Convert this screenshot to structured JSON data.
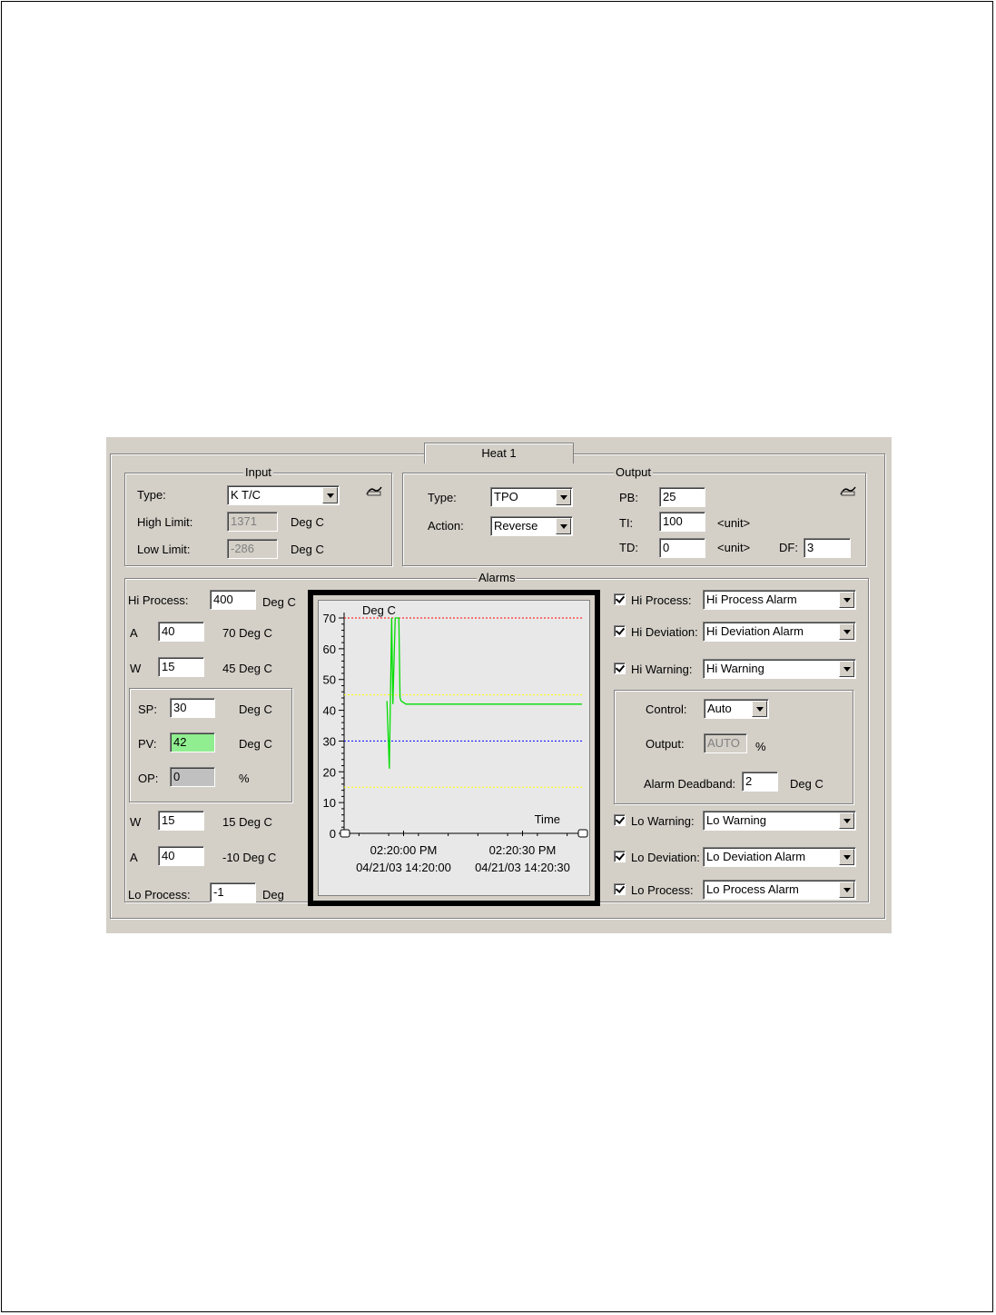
{
  "tab": {
    "label": "Heat 1"
  },
  "input": {
    "title": "Input",
    "type_label": "Type:",
    "type_value": "K T/C",
    "high_limit_label": "High Limit:",
    "high_limit_value": "1371",
    "high_limit_unit": "Deg C",
    "low_limit_label": "Low Limit:",
    "low_limit_value": "-286",
    "low_limit_unit": "Deg C"
  },
  "output": {
    "title": "Output",
    "type_label": "Type:",
    "type_value": "TPO",
    "action_label": "Action:",
    "action_value": "Reverse",
    "pb_label": "PB:",
    "pb_value": "25",
    "ti_label": "TI:",
    "ti_value": "100",
    "ti_unit": "<unit>",
    "td_label": "TD:",
    "td_value": "0",
    "td_unit": "<unit>",
    "df_label": "DF:",
    "df_value": "3"
  },
  "alarms": {
    "title": "Alarms",
    "hi_process_label": "Hi Process:",
    "hi_process_value": "400",
    "hi_process_unit": "Deg C",
    "a_hi_label": "A",
    "a_hi_value": "40",
    "a_hi_result": "70  Deg C",
    "w_hi_label": "W",
    "w_hi_value": "15",
    "w_hi_result": "45  Deg C",
    "sp_label": "SP:",
    "sp_value": "30",
    "sp_unit": "Deg C",
    "pv_label": "PV:",
    "pv_value": "42",
    "pv_unit": "Deg C",
    "op_label": "OP:",
    "op_value": "0",
    "op_unit": "%",
    "w_lo_label": "W",
    "w_lo_value": "15",
    "w_lo_result": "15  Deg C",
    "a_lo_label": "A",
    "a_lo_value": "40",
    "a_lo_result": "-10  Deg C",
    "lo_process_label": "Lo Process:",
    "lo_process_value": "-1",
    "lo_process_unit": "Deg",
    "right": {
      "hi_process_label": "Hi Process:",
      "hi_process_value": "Hi Process Alarm",
      "hi_deviation_label": "Hi Deviation:",
      "hi_deviation_value": "Hi Deviation Alarm",
      "hi_warning_label": "Hi Warning:",
      "hi_warning_value": "Hi Warning",
      "control_label": "Control:",
      "control_value": "Auto",
      "output_label": "Output:",
      "output_value": "AUTO",
      "output_unit": "%",
      "deadband_label": "Alarm Deadband:",
      "deadband_value": "2",
      "deadband_unit": "Deg C",
      "lo_warning_label": "Lo Warning:",
      "lo_warning_value": "Lo Warning",
      "lo_deviation_label": "Lo Deviation:",
      "lo_deviation_value": "Lo Deviation Alarm",
      "lo_process_label": "Lo Process:",
      "lo_process_value": "Lo Process Alarm"
    }
  },
  "colors": {
    "panel": "#d4d0c8",
    "pv_line": "#00dd00",
    "alarm_line": "#ff0000",
    "warning_line": "#ffff00",
    "setpoint_line": "#0000ff"
  },
  "chart_data": {
    "type": "line",
    "ylabel": "Deg C",
    "xlabel": "Time",
    "ylim": [
      0,
      70
    ],
    "yticks": [
      0,
      10,
      20,
      30,
      40,
      50,
      60,
      70
    ],
    "xlim": [
      0,
      40
    ],
    "xticks": [
      {
        "x": 10,
        "line1": "02:20:00 PM",
        "line2": "04/21/03 14:20:00"
      },
      {
        "x": 30,
        "line1": "02:20:30 PM",
        "line2": "04/21/03 14:20:30"
      }
    ],
    "reference_lines": [
      {
        "y": 70,
        "color": "#ff0000"
      },
      {
        "y": 45,
        "color": "#ffff00"
      },
      {
        "y": 30,
        "color": "#0000ff"
      },
      {
        "y": 15,
        "color": "#ffff00"
      },
      {
        "y": 0,
        "color": "#ff0000"
      }
    ],
    "series": [
      {
        "color": "#00dd00",
        "x": [
          7.2,
          7.6,
          8.0,
          8.2,
          8.6,
          9.2,
          9.4,
          9.6,
          10.4,
          40
        ],
        "y": [
          43,
          21,
          70,
          42,
          70,
          70,
          44,
          43,
          42,
          42
        ]
      }
    ]
  }
}
